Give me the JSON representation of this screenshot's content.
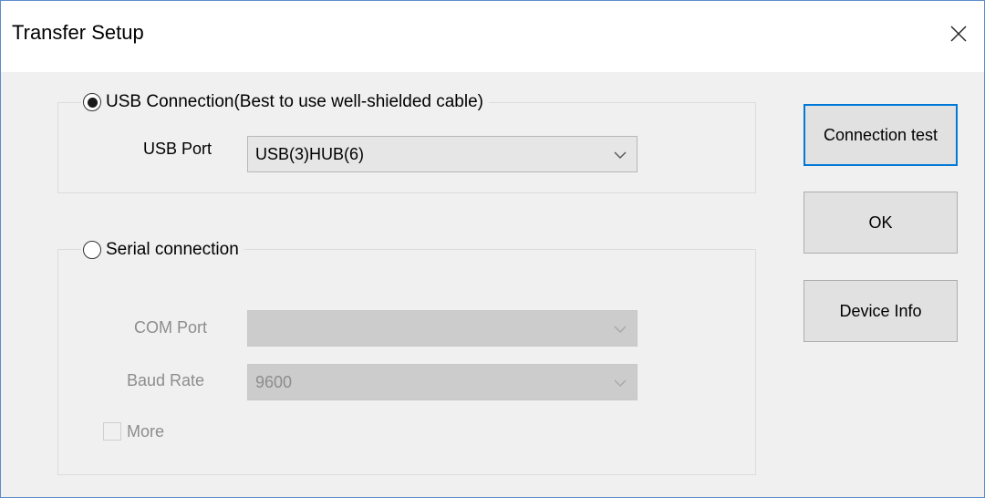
{
  "window": {
    "title": "Transfer Setup"
  },
  "usb": {
    "radio_label": "USB Connection(Best to use well-shielded cable)",
    "selected": true,
    "port_label": "USB Port",
    "port_value": "USB(3)HUB(6)"
  },
  "serial": {
    "radio_label": "Serial connection",
    "selected": false,
    "com_label": "COM Port",
    "com_value": "",
    "baud_label": "Baud Rate",
    "baud_value": "9600",
    "more_label": "More"
  },
  "buttons": {
    "connection_test": "Connection test",
    "ok": "OK",
    "device_info": "Device Info"
  },
  "colors": {
    "focus_border": "#0078d7",
    "window_border": "#5b8cc9",
    "disabled_text": "#8d8d8d"
  },
  "icons": [
    "close-icon",
    "chevron-down-icon"
  ]
}
